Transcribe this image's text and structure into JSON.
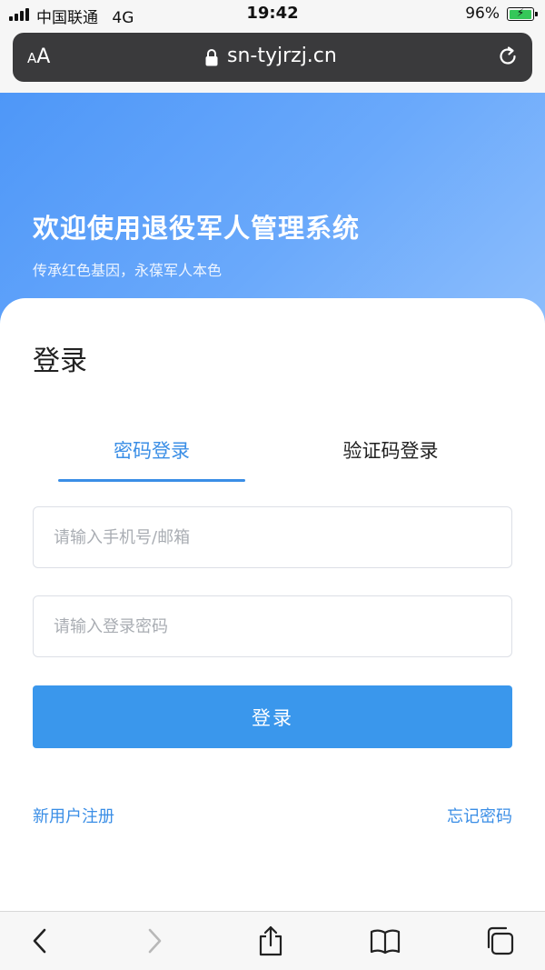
{
  "status_bar": {
    "carrier": "中国联通",
    "network": "4G",
    "time": "19:42",
    "battery": "96%",
    "battery_color": "#35c759"
  },
  "browser": {
    "text_size_label": "AA",
    "url": "sn-tyjrzj.cn",
    "lock_icon": "lock-icon",
    "reload_icon": "reload-icon"
  },
  "hero": {
    "title": "欢迎使用退役军人管理系统",
    "subtitle": "传承红色基因，永葆军人本色"
  },
  "login": {
    "heading": "登录",
    "tabs": [
      {
        "label": "密码登录",
        "active": true
      },
      {
        "label": "验证码登录",
        "active": false
      }
    ],
    "phone_placeholder": "请输入手机号/邮箱",
    "password_placeholder": "请输入登录密码",
    "submit_label": "登录",
    "register_link": "新用户注册",
    "forgot_link": "忘记密码",
    "accent_color": "#3a8ee6"
  },
  "toolbar": {
    "icons": [
      "back-icon",
      "forward-icon",
      "share-icon",
      "bookmarks-icon",
      "tabs-icon"
    ]
  }
}
